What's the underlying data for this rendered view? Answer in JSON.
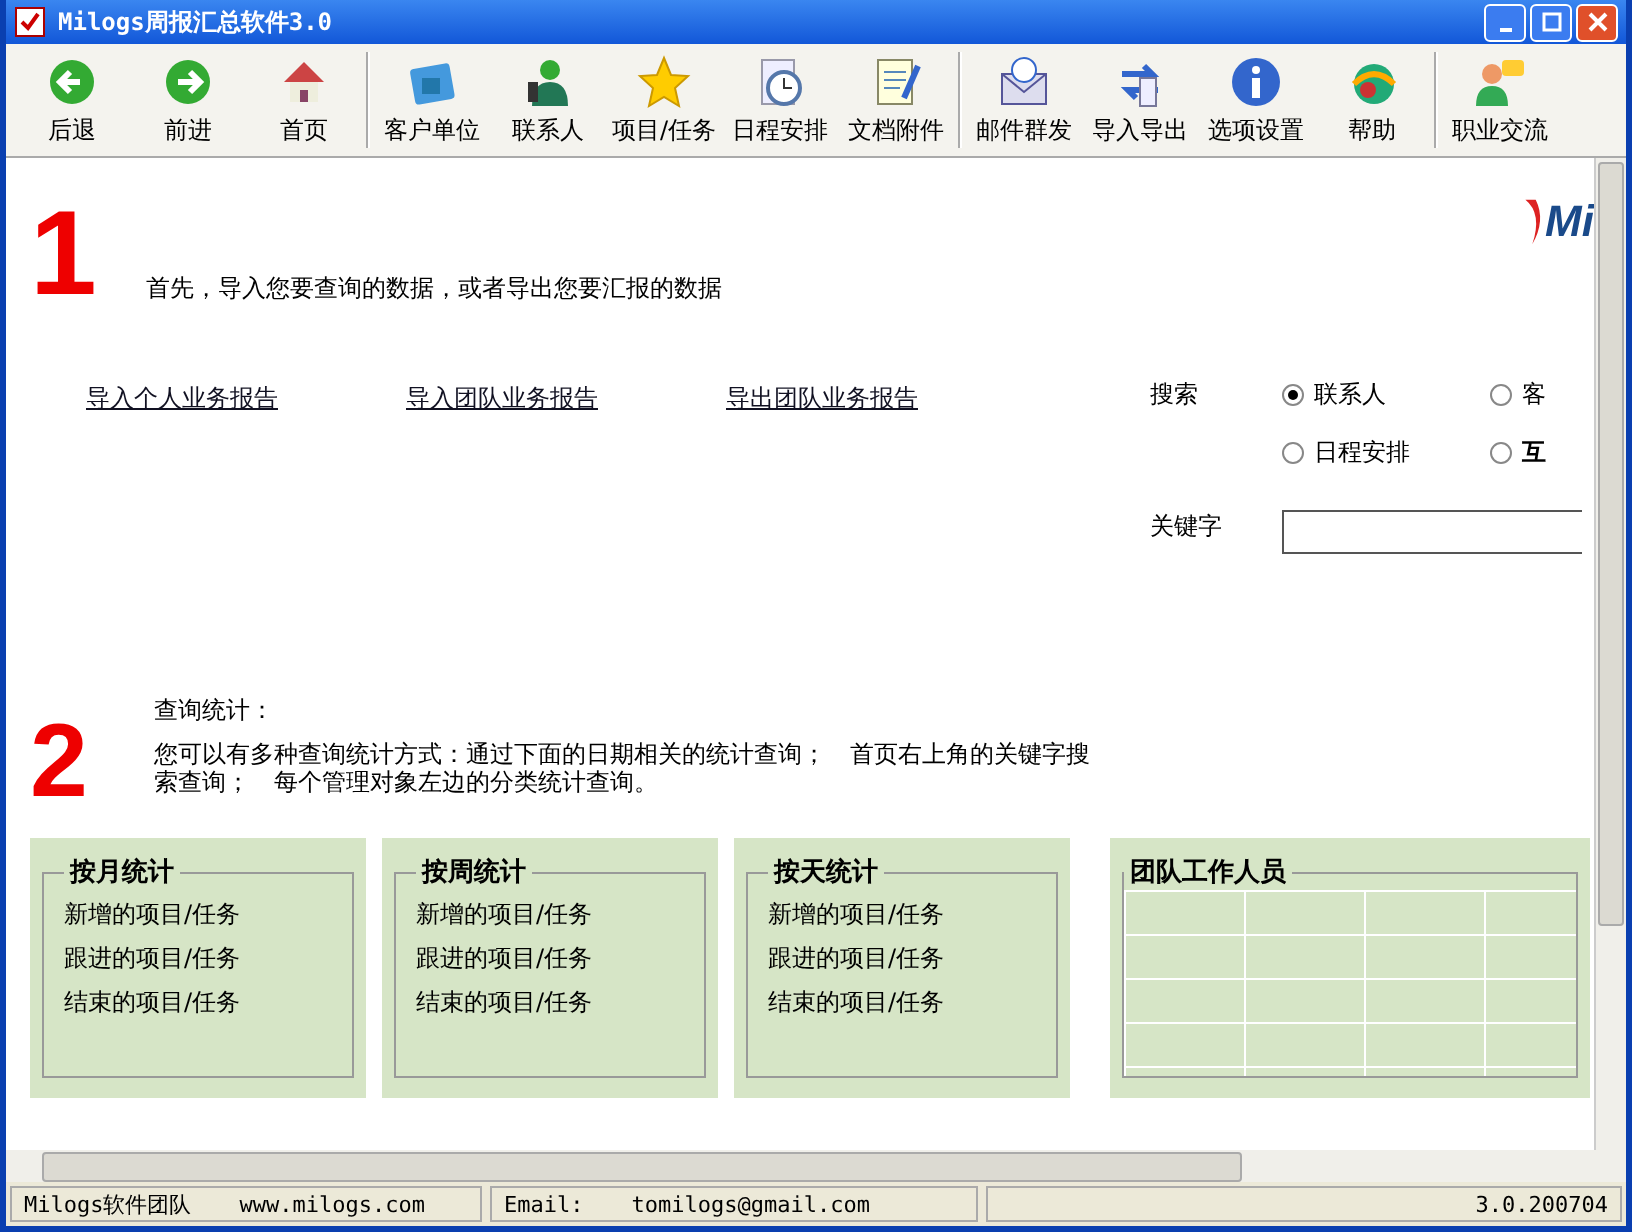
{
  "window": {
    "title": "Milogs周报汇总软件3.0"
  },
  "toolbar": [
    [
      {
        "label": "后退"
      },
      {
        "label": "前进"
      },
      {
        "label": "首页"
      }
    ],
    [
      {
        "label": "客户单位"
      },
      {
        "label": "联系人"
      },
      {
        "label": "项目/任务"
      },
      {
        "label": "日程安排"
      },
      {
        "label": "文档附件"
      }
    ],
    [
      {
        "label": "邮件群发"
      },
      {
        "label": "导入导出"
      },
      {
        "label": "选项设置"
      },
      {
        "label": "帮助"
      }
    ],
    [
      {
        "label": "职业交流"
      }
    ]
  ],
  "logo": {
    "text": "Mi"
  },
  "step1": {
    "number": "1",
    "text": "首先，导入您要查询的数据，或者导出您要汇报的数据",
    "links": [
      "导入个人业务报告",
      "导入团队业务报告",
      "导出团队业务报告"
    ]
  },
  "search": {
    "label": "搜索",
    "options": [
      {
        "label": "联系人",
        "selected": true
      },
      {
        "label": "客",
        "selected": false
      },
      {
        "label": "日程安排",
        "selected": false
      },
      {
        "label": "互",
        "selected": false
      }
    ],
    "keyword_label": "关键字"
  },
  "step2": {
    "number": "2",
    "title": "查询统计：",
    "text": "您可以有多种查询统计方式：通过下面的日期相关的统计查询；　首页右上角的关键字搜索查询；　每个管理对象左边的分类统计查询。"
  },
  "stat_panels": [
    {
      "title": "按月统计",
      "items": [
        "新增的项目/任务",
        "跟进的项目/任务",
        "结束的项目/任务"
      ]
    },
    {
      "title": "按周统计",
      "items": [
        "新增的项目/任务",
        "跟进的项目/任务",
        "结束的项目/任务"
      ]
    },
    {
      "title": "按天统计",
      "items": [
        "新增的项目/任务",
        "跟进的项目/任务",
        "结束的项目/任务"
      ]
    }
  ],
  "team_panel": {
    "title": "团队工作人员"
  },
  "status_bar": {
    "team": "Milogs软件团队",
    "website": "www.milogs.com",
    "email_label": "Email:",
    "email": "tomilogs@gmail.com",
    "version": "3.0.200704"
  }
}
